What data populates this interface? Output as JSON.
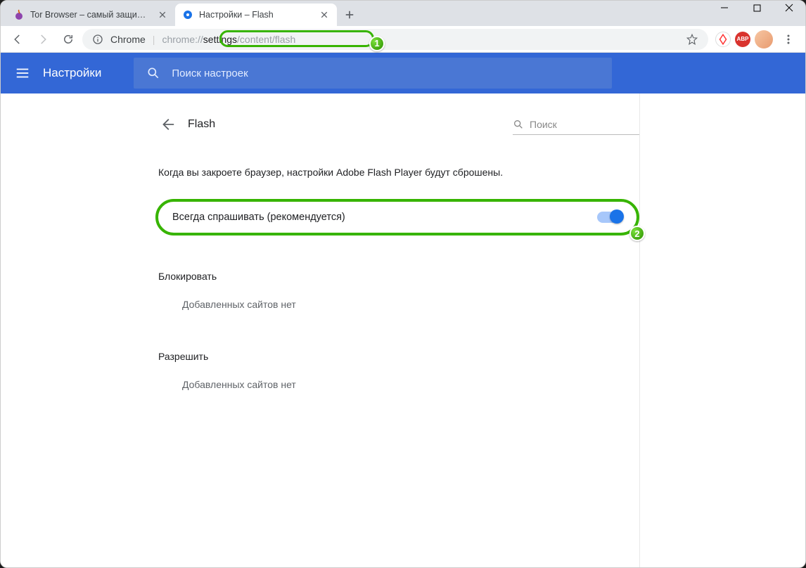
{
  "window": {
    "controls": {
      "min": "−",
      "max": "□",
      "close": "✕"
    }
  },
  "tabs": [
    {
      "title": "Tor Browser – самый защищенн",
      "favicon": "onion",
      "active": false
    },
    {
      "title": "Настройки – Flash",
      "favicon": "gear",
      "active": true
    }
  ],
  "toolbar": {
    "chrome_label": "Chrome",
    "url_prefix": "chrome://",
    "url_mid": "settings",
    "url_suffix": "/content/flash"
  },
  "extensions": {
    "yandex": "Y",
    "adblock": "ABP"
  },
  "header": {
    "title": "Настройки",
    "search_placeholder": "Поиск настроек"
  },
  "page": {
    "back_label": "Назад",
    "title": "Flash",
    "search_placeholder": "Поиск",
    "notice": "Когда вы закроете браузер, настройки Adobe Flash Player будут сброшены.",
    "toggle_label": "Всегда спрашивать (рекомендуется)",
    "block_heading": "Блокировать",
    "block_empty": "Добавленных сайтов нет",
    "allow_heading": "Разрешить",
    "allow_empty": "Добавленных сайтов нет"
  },
  "annotations": {
    "badge1": "1",
    "badge2": "2"
  }
}
